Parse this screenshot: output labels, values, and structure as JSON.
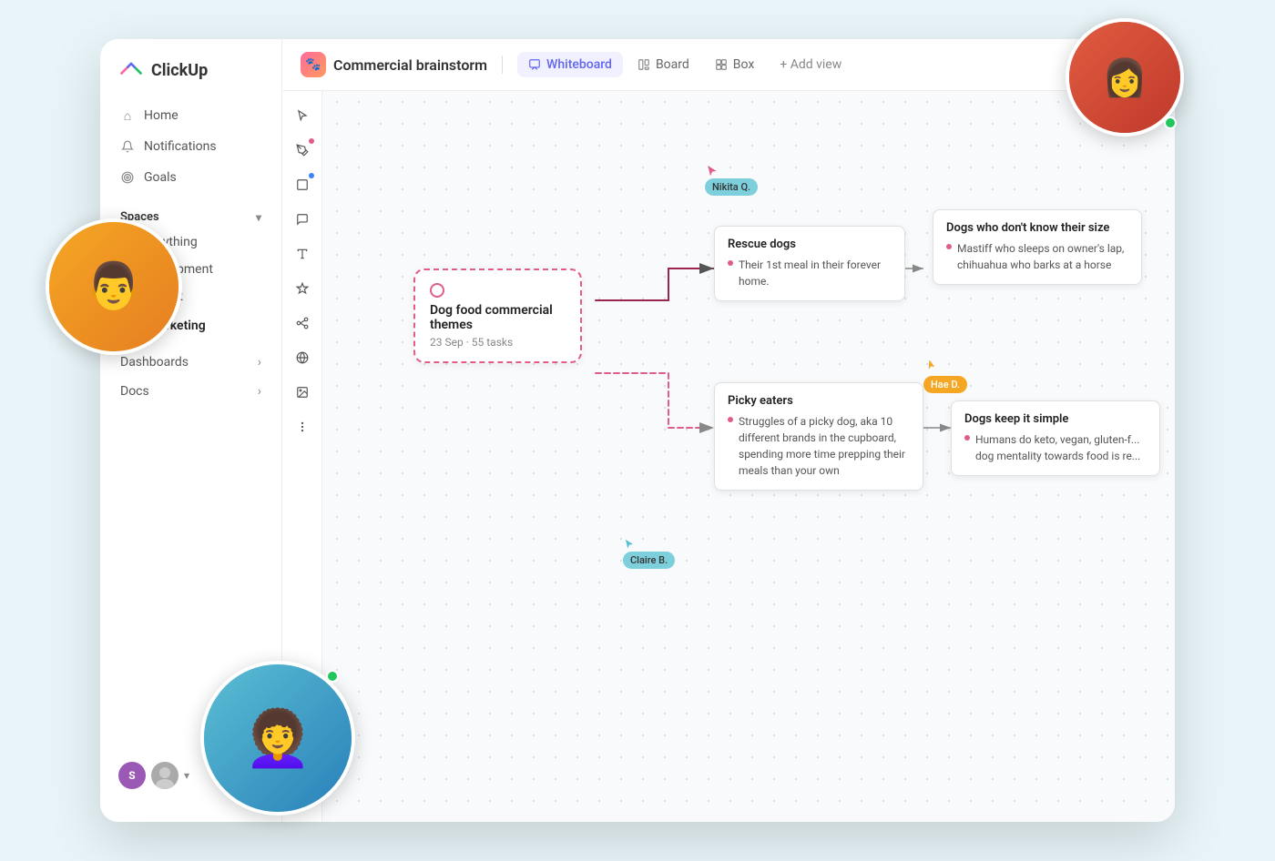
{
  "app": {
    "name": "ClickUp"
  },
  "sidebar": {
    "nav": [
      {
        "id": "home",
        "label": "Home",
        "icon": "⌂"
      },
      {
        "id": "notifications",
        "label": "Notifications",
        "icon": "🔔"
      },
      {
        "id": "goals",
        "label": "Goals",
        "icon": "🏆"
      }
    ],
    "spaces_label": "Spaces",
    "spaces": [
      {
        "id": "everything",
        "label": "Everything",
        "color": "#22c55e"
      },
      {
        "id": "development",
        "label": "Development",
        "color": "#3b82f6"
      },
      {
        "id": "product",
        "label": "Product",
        "color": "#f97316"
      },
      {
        "id": "marketing",
        "label": "Marketing",
        "is_bold": true
      }
    ],
    "dashboards_label": "Dashboards",
    "docs_label": "Docs"
  },
  "header": {
    "project_label": "Commercial brainstorm",
    "tabs": [
      {
        "id": "whiteboard",
        "label": "Whiteboard",
        "active": true
      },
      {
        "id": "board",
        "label": "Board",
        "active": false
      },
      {
        "id": "box",
        "label": "Box",
        "active": false
      }
    ],
    "add_view_label": "+ Add view"
  },
  "whiteboard": {
    "toolbar_tools": [
      "cursor",
      "pen",
      "rectangle",
      "note",
      "text",
      "sparkle",
      "connections",
      "globe",
      "image",
      "more"
    ],
    "cards": [
      {
        "id": "rescue-dogs",
        "title": "Rescue dogs",
        "bullet": "Their 1st meal in their forever home."
      },
      {
        "id": "dogs-size",
        "title": "Dogs who don't know their size",
        "bullet": "Mastiff who sleeps on owner's lap, chihuahua who barks at a horse"
      },
      {
        "id": "picky-eaters",
        "title": "Picky eaters",
        "bullet": "Struggles of a picky dog, aka 10 different brands in the cupboard, spending more time prepping their meals than your own"
      },
      {
        "id": "dogs-simple",
        "title": "Dogs keep it simple",
        "bullet": "Humans do keto, vegan, gluten-f... dog mentality towards food is re..."
      }
    ],
    "main_card": {
      "title": "Dog food commercial themes",
      "subtitle": "23 Sep · 55 tasks"
    },
    "cursors": [
      {
        "id": "nikita",
        "label": "Nikita Q."
      },
      {
        "id": "hae",
        "label": "Hae D."
      },
      {
        "id": "claire",
        "label": "Claire B."
      }
    ]
  },
  "avatars": [
    {
      "id": "s",
      "letter": "S",
      "color": "#9b59b6"
    },
    {
      "id": "u",
      "letter": "",
      "color": "#aaa"
    }
  ]
}
